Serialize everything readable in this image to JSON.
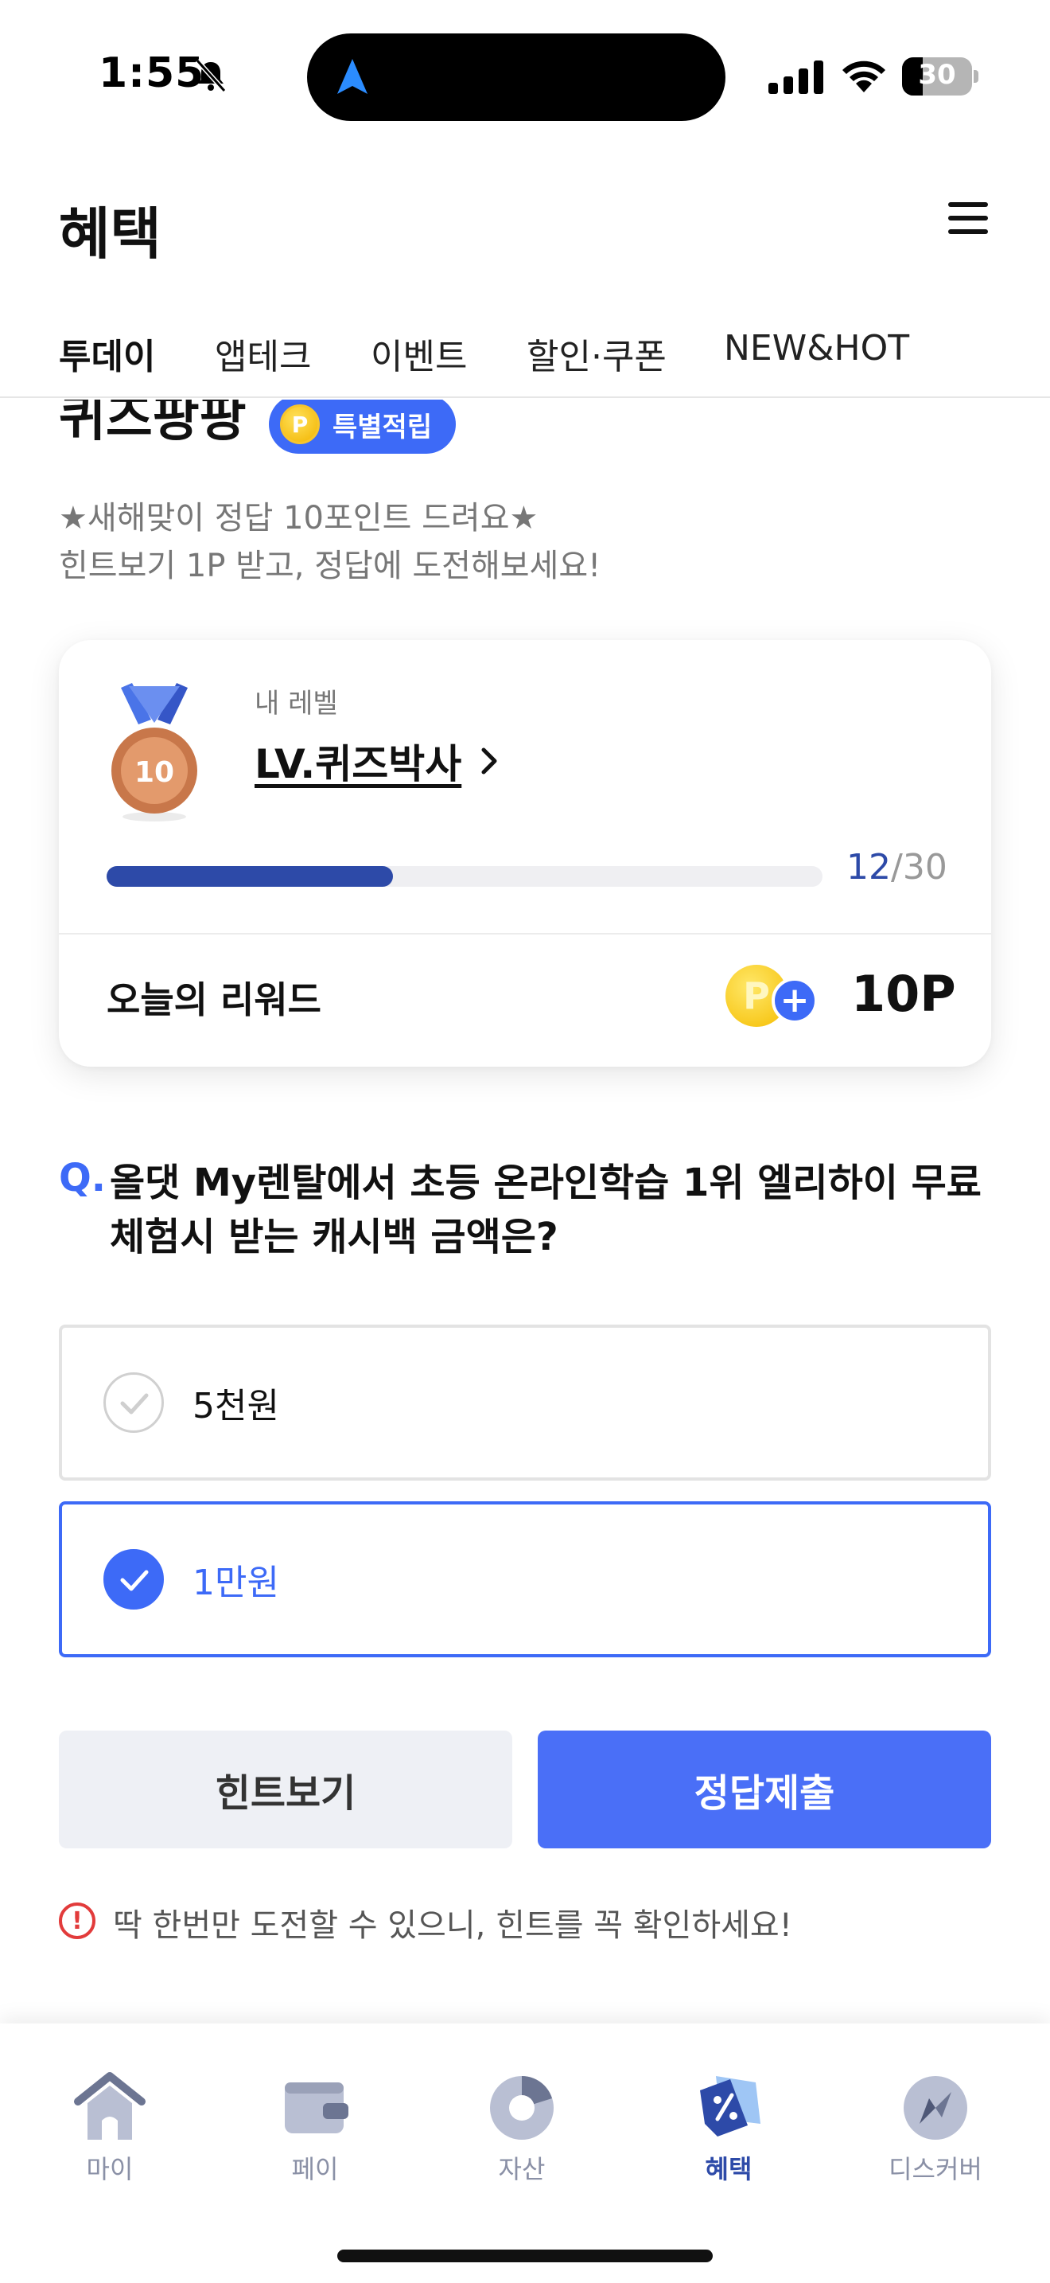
{
  "status_bar": {
    "time": "1:55",
    "battery_level": "30",
    "battery_fraction": 0.3
  },
  "header": {
    "title": "혜택",
    "menu_icon": "hamburger-menu-icon"
  },
  "tabs": [
    {
      "label": "투데이",
      "active": true
    },
    {
      "label": "앱테크",
      "active": false
    },
    {
      "label": "이벤트",
      "active": false
    },
    {
      "label": "할인·쿠폰",
      "active": false
    },
    {
      "label": "NEW&HOT",
      "active": false
    }
  ],
  "quiz": {
    "title": "퀴즈팡팡",
    "badge_coin": "P",
    "badge_label": "특별적립",
    "desc_line1": "★새해맞이 정답 10포인트 드려요★",
    "desc_line2": "힌트보기 1P 받고, 정답에 도전해보세요!"
  },
  "level_card": {
    "medal_number": "10",
    "caption": "내 레벨",
    "level_name": "LV.퀴즈박사",
    "progress_current": "12",
    "progress_separator": "/",
    "progress_total": "30",
    "progress_fraction": 0.4,
    "reward_label": "오늘의 리워드",
    "reward_coin": "P",
    "reward_plus": "+",
    "reward_value": "10P"
  },
  "question": {
    "prefix": "Q.",
    "text": "올댓 My렌탈에서 초등 온라인학습 1위 엘리하이 무료 체험시 받는 캐시백 금액은?",
    "options": [
      {
        "label": "5천원",
        "selected": false
      },
      {
        "label": "1만원",
        "selected": true
      }
    ]
  },
  "actions": {
    "hint_label": "힌트보기",
    "submit_label": "정답제출"
  },
  "warning": {
    "icon": "!",
    "text": "딱 한번만 도전할 수 있으니, 힌트를 꼭 확인하세요!"
  },
  "bottom_nav": [
    {
      "label": "마이",
      "icon": "home-icon",
      "active": false
    },
    {
      "label": "페이",
      "icon": "wallet-icon",
      "active": false
    },
    {
      "label": "자산",
      "icon": "pie-chart-icon",
      "active": false
    },
    {
      "label": "혜택",
      "icon": "coupon-tag-icon",
      "active": true
    },
    {
      "label": "디스커버",
      "icon": "compass-icon",
      "active": false
    }
  ],
  "colors": {
    "accent": "#3d6af7",
    "level_blue": "#2d4aa8",
    "coin": "#f5bd00",
    "warning": "#e23b3b"
  }
}
